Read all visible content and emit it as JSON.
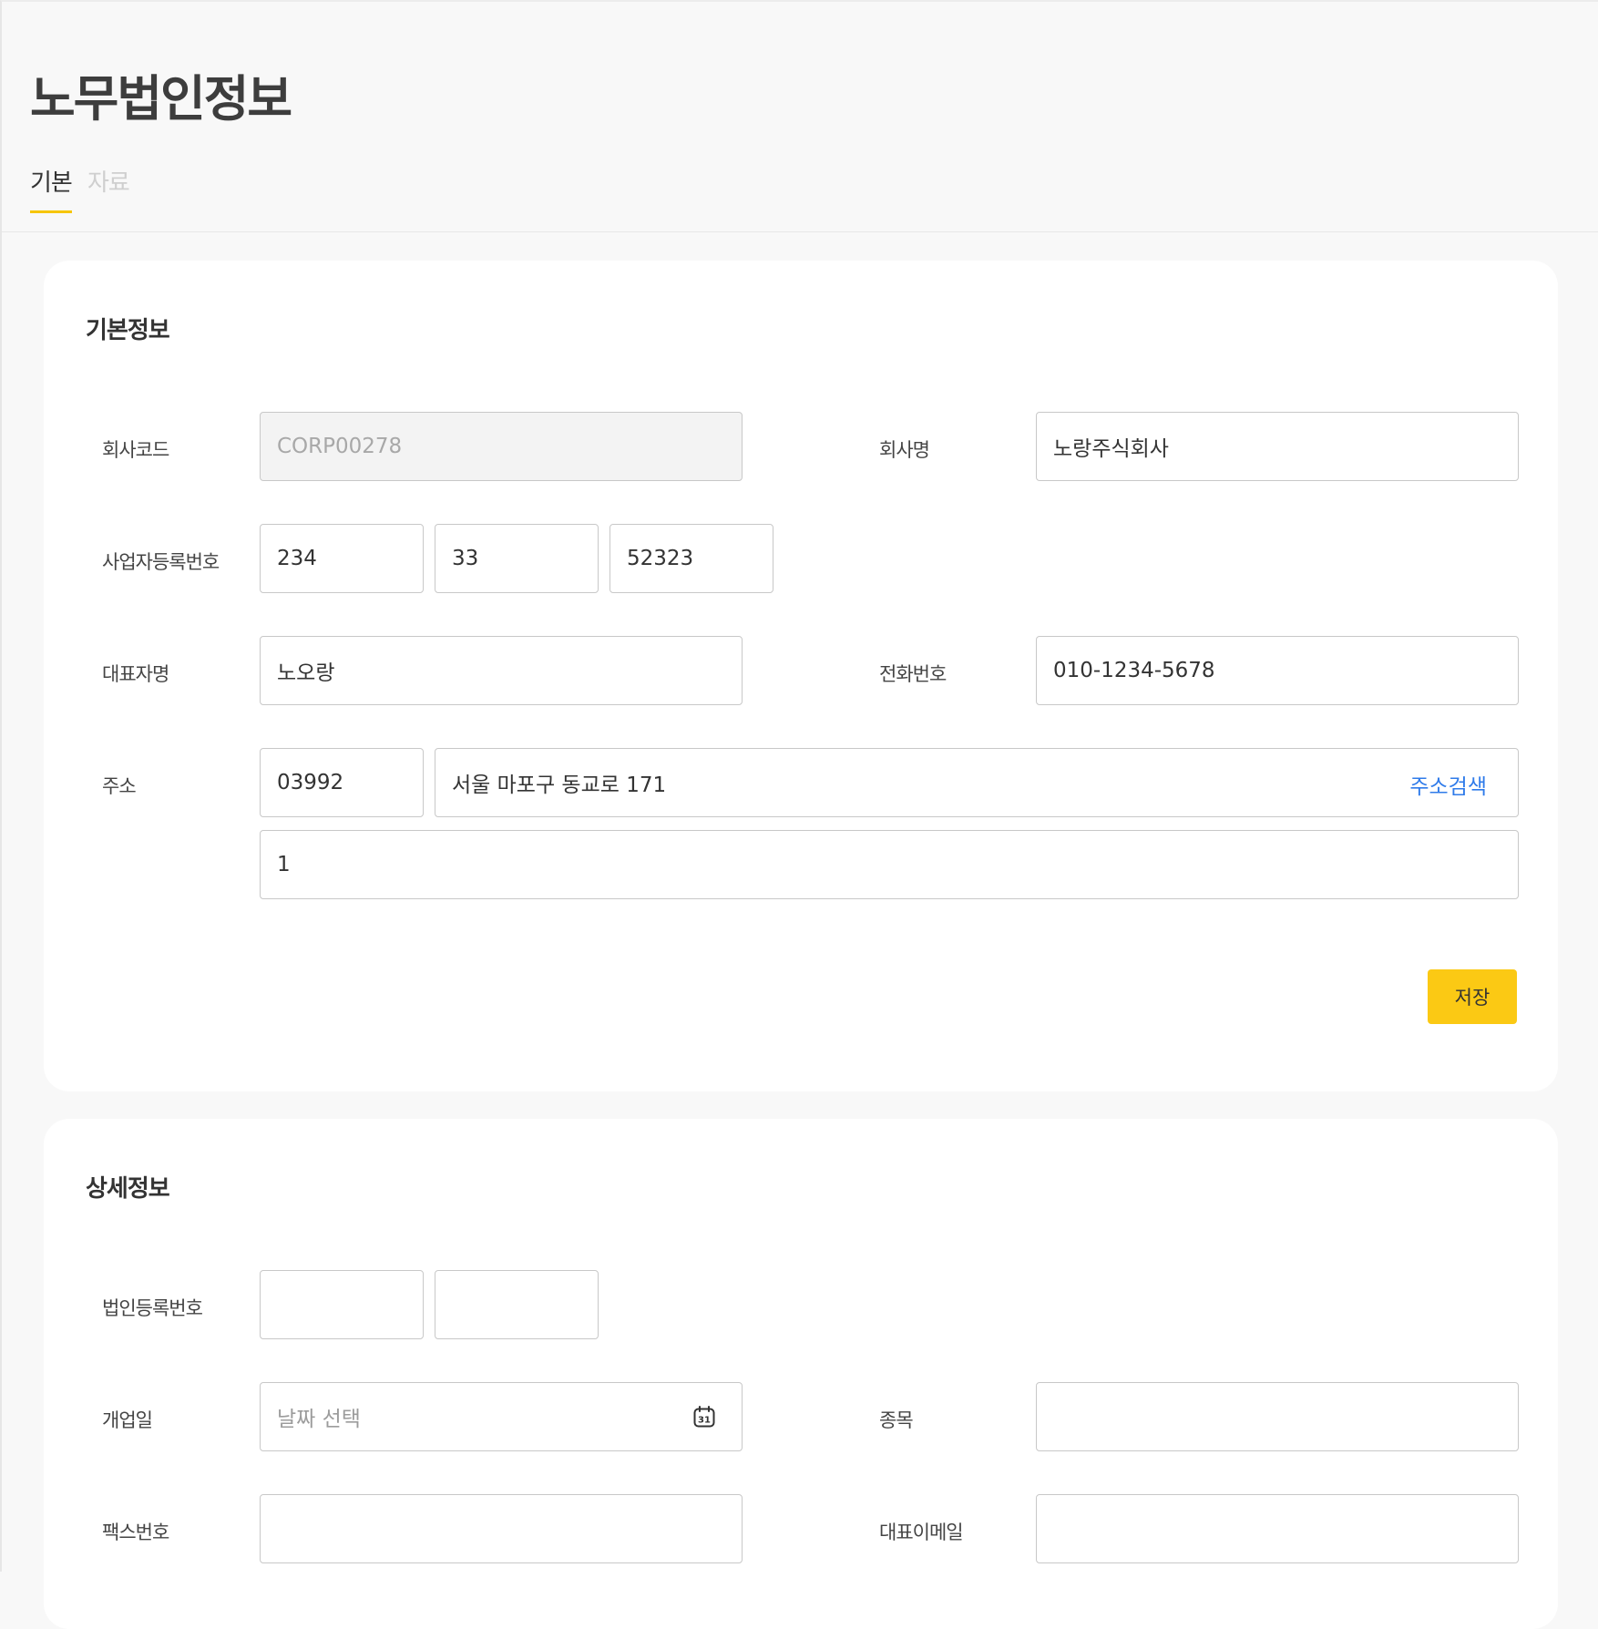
{
  "page": {
    "title": "노무법인정보"
  },
  "tabs": [
    {
      "label": "기본",
      "active": true
    },
    {
      "label": "자료",
      "active": false
    }
  ],
  "basic_info": {
    "title": "기본정보",
    "company_code": {
      "label": "회사코드",
      "value": "CORP00278"
    },
    "company_name": {
      "label": "회사명",
      "value": "노랑주식회사"
    },
    "business_reg_no": {
      "label": "사업자등록번호",
      "part1": "234",
      "part2": "33",
      "part3": "52323"
    },
    "representative": {
      "label": "대표자명",
      "value": "노오랑"
    },
    "phone": {
      "label": "전화번호",
      "value": "010-1234-5678"
    },
    "address": {
      "label": "주소",
      "zipcode": "03992",
      "address1": "서울 마포구 동교로 171",
      "search_label": "주소검색",
      "address2": "1"
    },
    "save_label": "저장"
  },
  "detail_info": {
    "title": "상세정보",
    "corp_reg_no": {
      "label": "법인등록번호",
      "part1": "",
      "part2": ""
    },
    "open_date": {
      "label": "개업일",
      "placeholder": "날짜 선택",
      "icon": "calendar-icon"
    },
    "item": {
      "label": "종목",
      "value": ""
    },
    "fax": {
      "label": "팩스번호",
      "value": ""
    },
    "email": {
      "label": "대표이메일",
      "value": ""
    }
  },
  "colors": {
    "accent": "#fbc914",
    "tab_underline": "#f6c500",
    "link": "#2f7bea",
    "background": "#f8f8f8"
  }
}
